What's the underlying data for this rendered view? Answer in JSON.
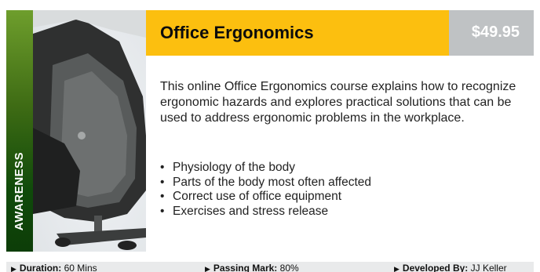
{
  "course": {
    "category": "AWARENESS",
    "title": "Office Ergonomics",
    "price": "$49.95",
    "description": "This online Office Ergonomics course explains how to recognize ergonomic hazards and explores practical solutions that can be used to address ergonomic problems in the workplace.",
    "features": [
      "Physiology of the body",
      "Parts of the body most often affected",
      "Correct use of office equipment",
      "Exercises and stress release"
    ]
  },
  "footer": {
    "duration_label": "Duration:",
    "duration_value": "60 Mins",
    "passing_label": "Passing Mark:",
    "passing_value": "80%",
    "developer_label": "Developed By:",
    "developer_value": "JJ Keller"
  },
  "colors": {
    "header_bg": "#fcbf0f",
    "price_bg": "#bfc2c4",
    "strip_top": "#6e9e2c",
    "strip_bottom": "#0d3d08",
    "footer_bg": "#e9eaeb"
  }
}
